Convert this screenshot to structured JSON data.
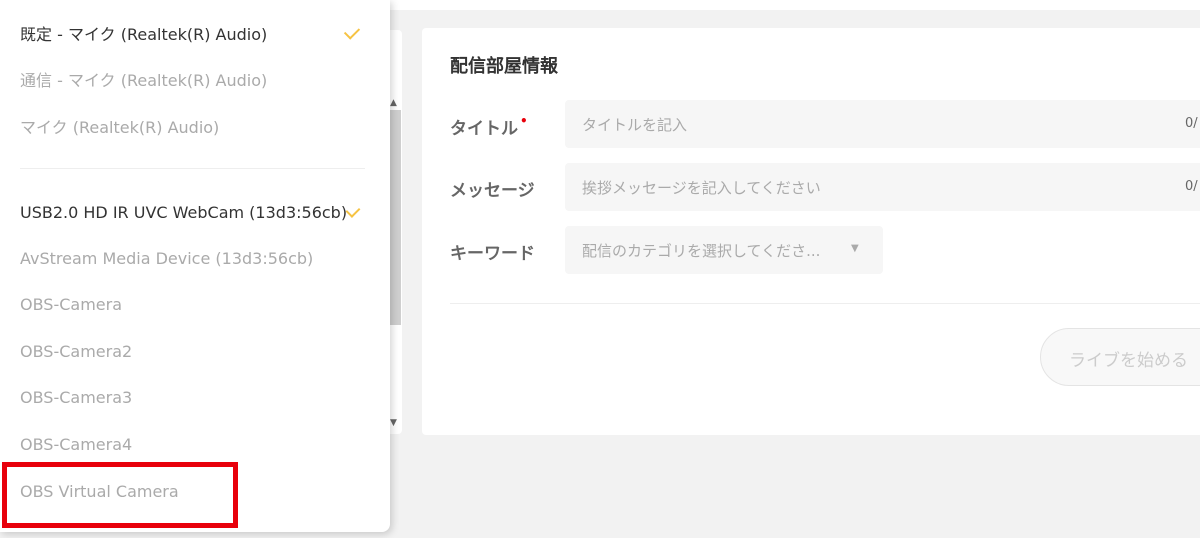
{
  "audio_devices": [
    {
      "label": "既定 - マイク (Realtek(R) Audio)",
      "selected": true
    },
    {
      "label": "通信 - マイク (Realtek(R) Audio)",
      "selected": false
    },
    {
      "label": "マイク (Realtek(R) Audio)",
      "selected": false
    }
  ],
  "video_devices": [
    {
      "label": "USB2.0 HD IR UVC WebCam (13d3:56cb)",
      "selected": true
    },
    {
      "label": "AvStream Media Device (13d3:56cb)",
      "selected": false
    },
    {
      "label": "OBS-Camera",
      "selected": false
    },
    {
      "label": "OBS-Camera2",
      "selected": false
    },
    {
      "label": "OBS-Camera3",
      "selected": false
    },
    {
      "label": "OBS-Camera4",
      "selected": false
    },
    {
      "label": "OBS Virtual Camera",
      "selected": false
    }
  ],
  "room_info": {
    "title": "配信部屋情報",
    "title_label": "タイトル",
    "required_mark": "•",
    "title_placeholder": "タイトルを記入",
    "title_count": "0/",
    "message_label": "メッセージ",
    "message_placeholder": "挨拶メッセージを記入してください",
    "message_count": "0/",
    "keyword_label": "キーワード",
    "keyword_placeholder": "配信のカテゴリを選択してくださ...",
    "start_button": "ライブを始める"
  },
  "colors": {
    "accent_check": "#f6c343",
    "highlight": "#e8000b",
    "required": "#e8000b"
  }
}
